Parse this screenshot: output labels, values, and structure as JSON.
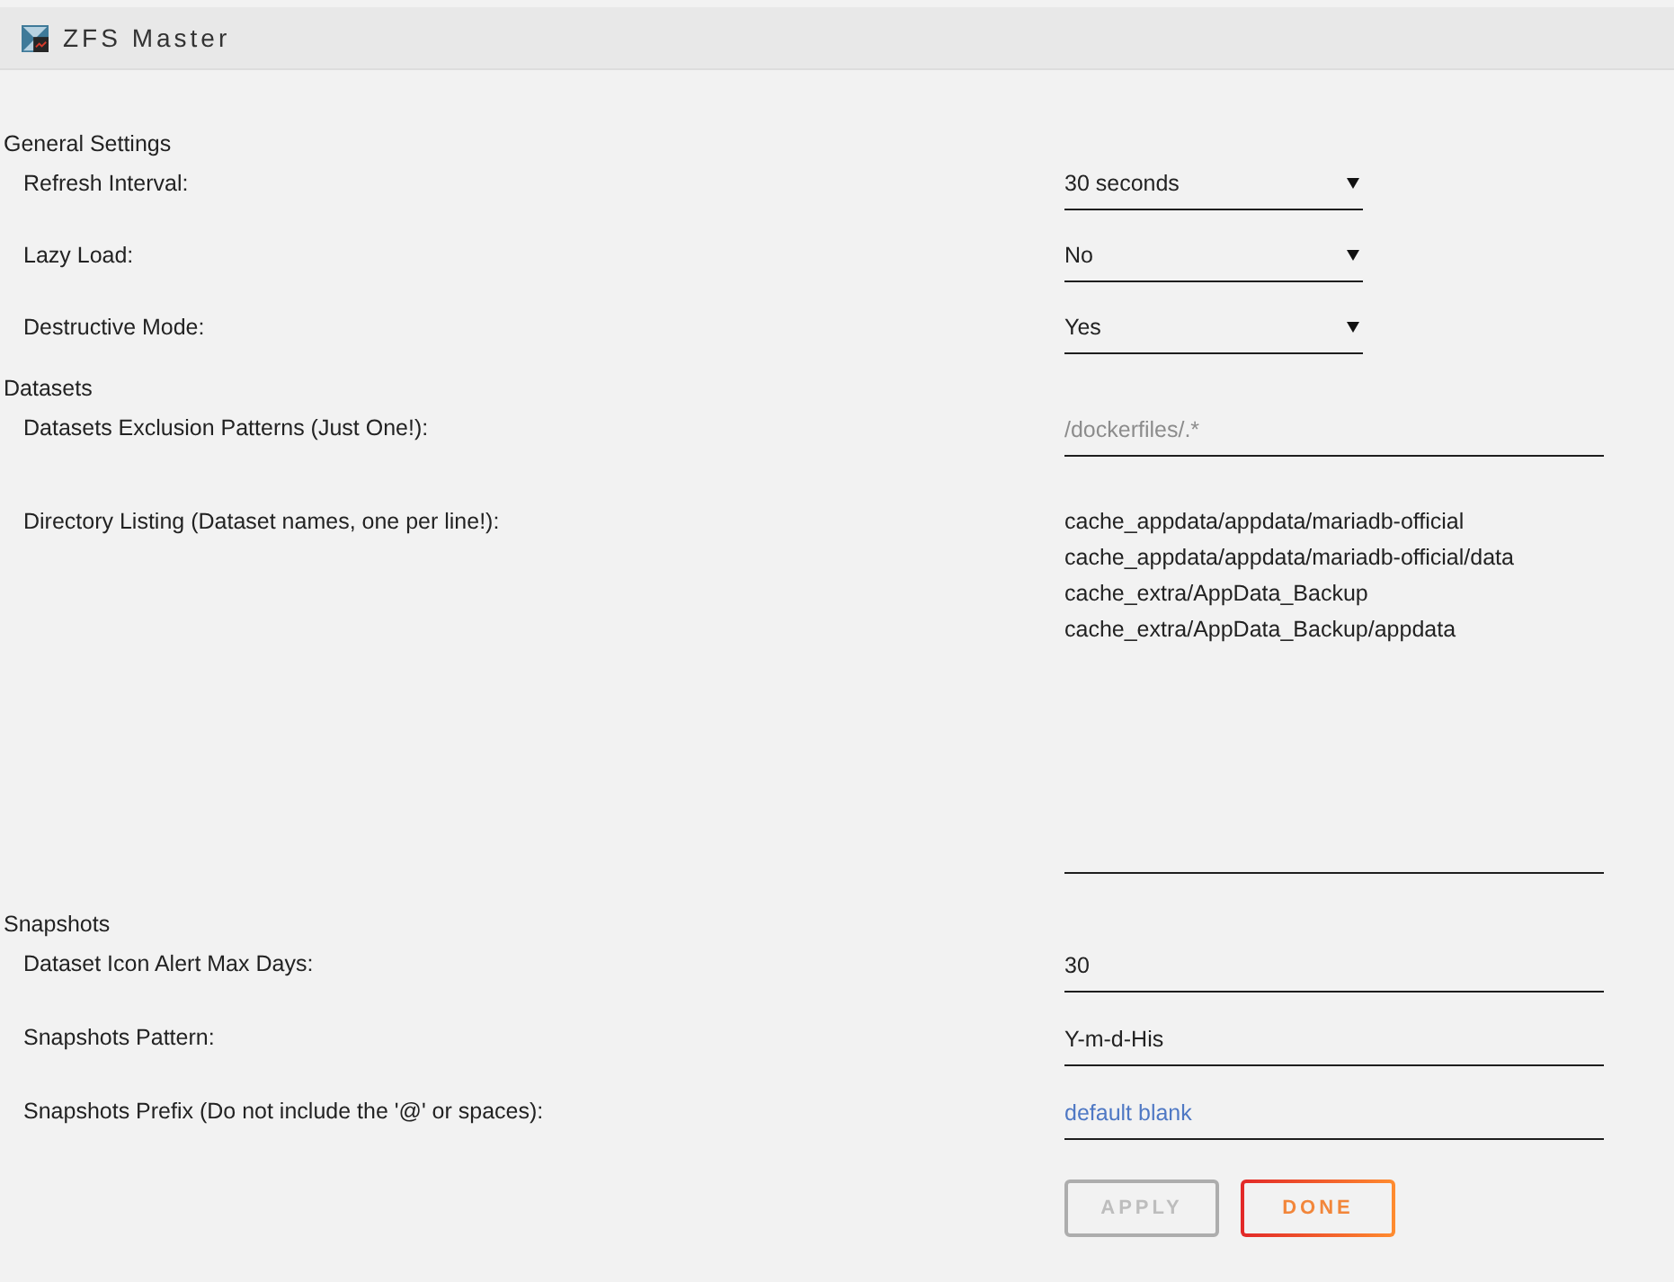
{
  "header": {
    "title": "ZFS Master"
  },
  "sections": [
    {
      "title": "General Settings",
      "rows": [
        {
          "label": "Refresh Interval:",
          "kind": "select",
          "value": "30 seconds"
        },
        {
          "label": "Lazy Load:",
          "kind": "select",
          "value": "No"
        },
        {
          "label": "Destructive Mode:",
          "kind": "select",
          "value": "Yes"
        }
      ]
    },
    {
      "title": "Datasets",
      "rows": [
        {
          "label": "Datasets Exclusion Patterns (Just One!):",
          "kind": "input",
          "placeholder": "/dockerfiles/.*",
          "color": "#8c8c8c"
        },
        {
          "label": "Directory Listing (Dataset names, one per line!):",
          "kind": "textarea",
          "lines": [
            "cache_appdata/appdata/mariadb-official",
            "cache_appdata/appdata/mariadb-official/data",
            "cache_extra/AppData_Backup",
            "cache_extra/AppData_Backup/appdata"
          ]
        }
      ]
    },
    {
      "title": "Snapshots",
      "rows": [
        {
          "label": "Dataset Icon Alert Max Days:",
          "kind": "input",
          "value": "30"
        },
        {
          "label": "Snapshots Pattern:",
          "kind": "input",
          "value": "Y-m-d-His"
        },
        {
          "label": "Snapshots Prefix (Do not include the '@' or spaces):",
          "kind": "input",
          "placeholder": "default blank",
          "color": "#4f78c4"
        }
      ]
    }
  ],
  "buttons": [
    {
      "label": "APPLY",
      "disabled": true
    },
    {
      "label": "DONE",
      "disabled": false
    }
  ]
}
